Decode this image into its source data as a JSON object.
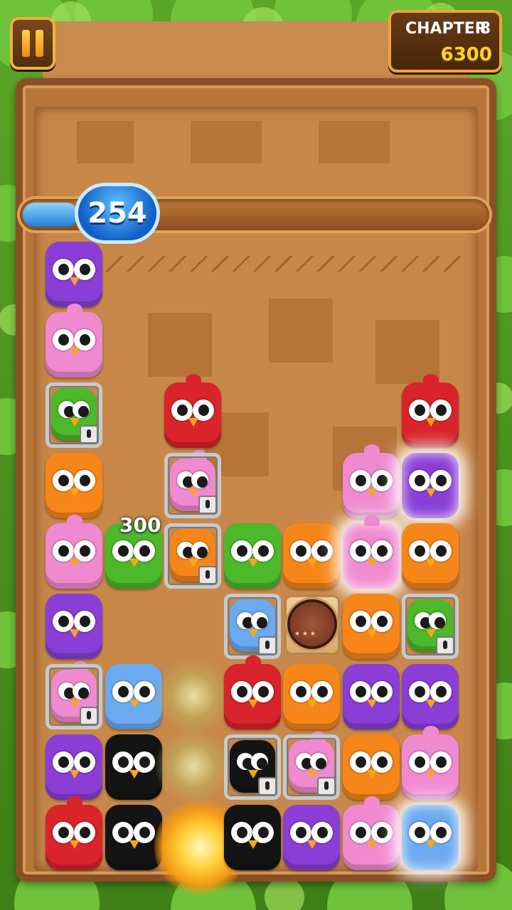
{
  "hud": {
    "pause_icon": "pause-icon",
    "chapter_label": "CHAPTER",
    "chapter_number": "8",
    "score": "6300"
  },
  "progress": {
    "moves_left": "254",
    "fill_fraction": 0.12
  },
  "popup_points": "300",
  "colors": {
    "purple": "#8a3ed6",
    "pink": "#f08ad0",
    "green": "#4cb82a",
    "orange": "#f7861a",
    "red": "#d8242a",
    "blue": "#6aaaf0",
    "black": "#141414",
    "locked_bg": "#b0b0b0"
  },
  "board": {
    "columns": 7,
    "rows": 9,
    "cells": [
      [
        "purple",
        null,
        null,
        null,
        null,
        null,
        null
      ],
      [
        "pink",
        null,
        null,
        null,
        null,
        null,
        null
      ],
      [
        "green-locked",
        null,
        "red",
        null,
        null,
        null,
        "red"
      ],
      [
        "orange",
        null,
        "pink-locked",
        null,
        null,
        "pink",
        "purple-glow"
      ],
      [
        "pink",
        "green",
        "orange-locked",
        "green",
        "orange",
        "pink-glow",
        "orange"
      ],
      [
        "purple",
        null,
        null,
        "blue-locked",
        "medal",
        "orange",
        "green-locked"
      ],
      [
        "pink-locked",
        "blue",
        "dust",
        "red",
        "orange",
        "purple",
        "purple"
      ],
      [
        "purple",
        "black",
        "dust",
        "black-locked",
        "pink-locked",
        "orange",
        "pink"
      ],
      [
        "red",
        "black",
        "explosion",
        "black",
        "purple",
        "pink",
        "blue-glow"
      ]
    ]
  }
}
